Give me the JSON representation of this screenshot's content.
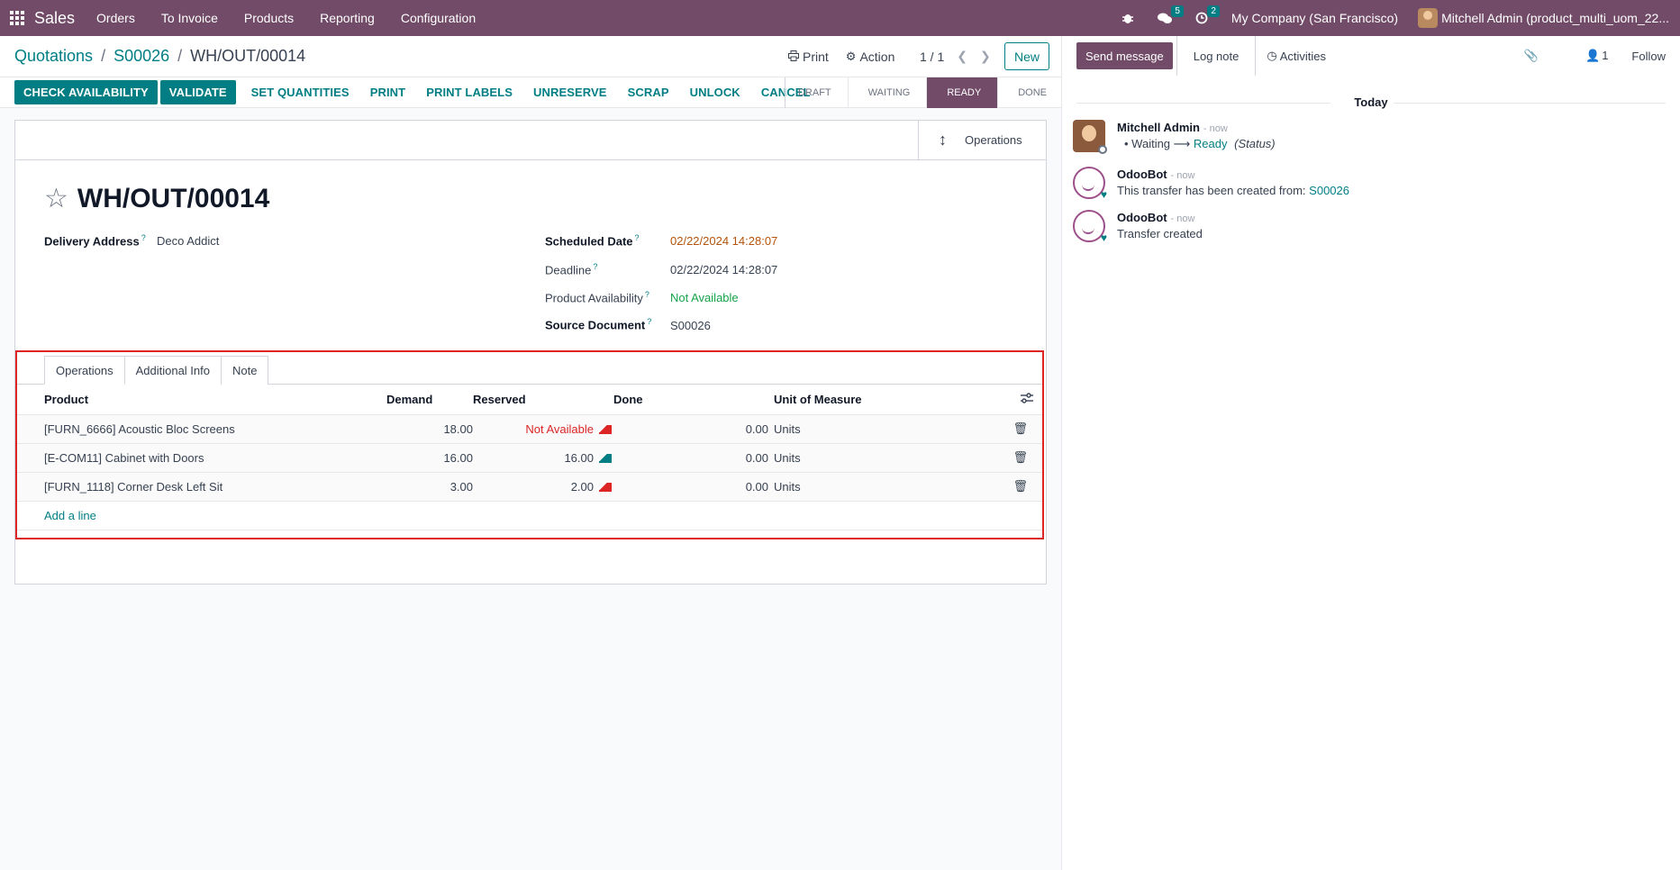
{
  "nav": {
    "app": "Sales",
    "items": [
      "Orders",
      "To Invoice",
      "Products",
      "Reporting",
      "Configuration"
    ],
    "chat_count": "5",
    "activity_count": "2",
    "company": "My Company (San Francisco)",
    "user": "Mitchell Admin (product_multi_uom_22..."
  },
  "breadcrumb": {
    "crumb1": "Quotations",
    "crumb2": "S00026",
    "current": "WH/OUT/00014"
  },
  "control": {
    "print": "Print",
    "action": "Action",
    "pager": "1 / 1",
    "new": "New"
  },
  "statusbar": {
    "buttons": [
      "CHECK AVAILABILITY",
      "VALIDATE",
      "SET QUANTITIES",
      "PRINT",
      "PRINT LABELS",
      "UNRESERVE",
      "SCRAP",
      "UNLOCK",
      "CANCEL"
    ],
    "stages": [
      "DRAFT",
      "WAITING",
      "READY",
      "DONE"
    ]
  },
  "sheet": {
    "smart_button": "Operations",
    "title": "WH/OUT/00014",
    "delivery_address_label": "Delivery Address",
    "delivery_address": "Deco Addict",
    "scheduled_date_label": "Scheduled Date",
    "scheduled_date": "02/22/2024 14:28:07",
    "deadline_label": "Deadline",
    "deadline": "02/22/2024 14:28:07",
    "availability_label": "Product Availability",
    "availability": "Not Available",
    "source_label": "Source Document",
    "source": "S00026"
  },
  "notebook": {
    "tabs": [
      "Operations",
      "Additional Info",
      "Note"
    ],
    "columns": {
      "product": "Product",
      "demand": "Demand",
      "reserved": "Reserved",
      "done": "Done",
      "uom": "Unit of Measure"
    },
    "rows": [
      {
        "product": "[FURN_6666] Acoustic Bloc Screens",
        "demand": "18.00",
        "reserved": "Not Available",
        "done": "0.00",
        "uom": "Units"
      },
      {
        "product": "[E-COM11] Cabinet with Doors",
        "demand": "16.00",
        "reserved": "16.00",
        "done": "0.00",
        "uom": "Units"
      },
      {
        "product": "[FURN_1118] Corner Desk Left Sit",
        "demand": "3.00",
        "reserved": "2.00",
        "done": "0.00",
        "uom": "Units"
      }
    ],
    "add_line": "Add a line"
  },
  "chatter": {
    "send": "Send message",
    "log": "Log note",
    "activities": "Activities",
    "followers": "1",
    "follow": "Follow",
    "today": "Today",
    "messages": [
      {
        "author": "Mitchell Admin",
        "time": "- now",
        "from": "Waiting",
        "to": "Ready",
        "field": "(Status)"
      },
      {
        "author": "OdooBot",
        "time": "- now",
        "text": "This transfer has been created from:",
        "link": "S00026"
      },
      {
        "author": "OdooBot",
        "time": "- now",
        "text": "Transfer created"
      }
    ]
  }
}
